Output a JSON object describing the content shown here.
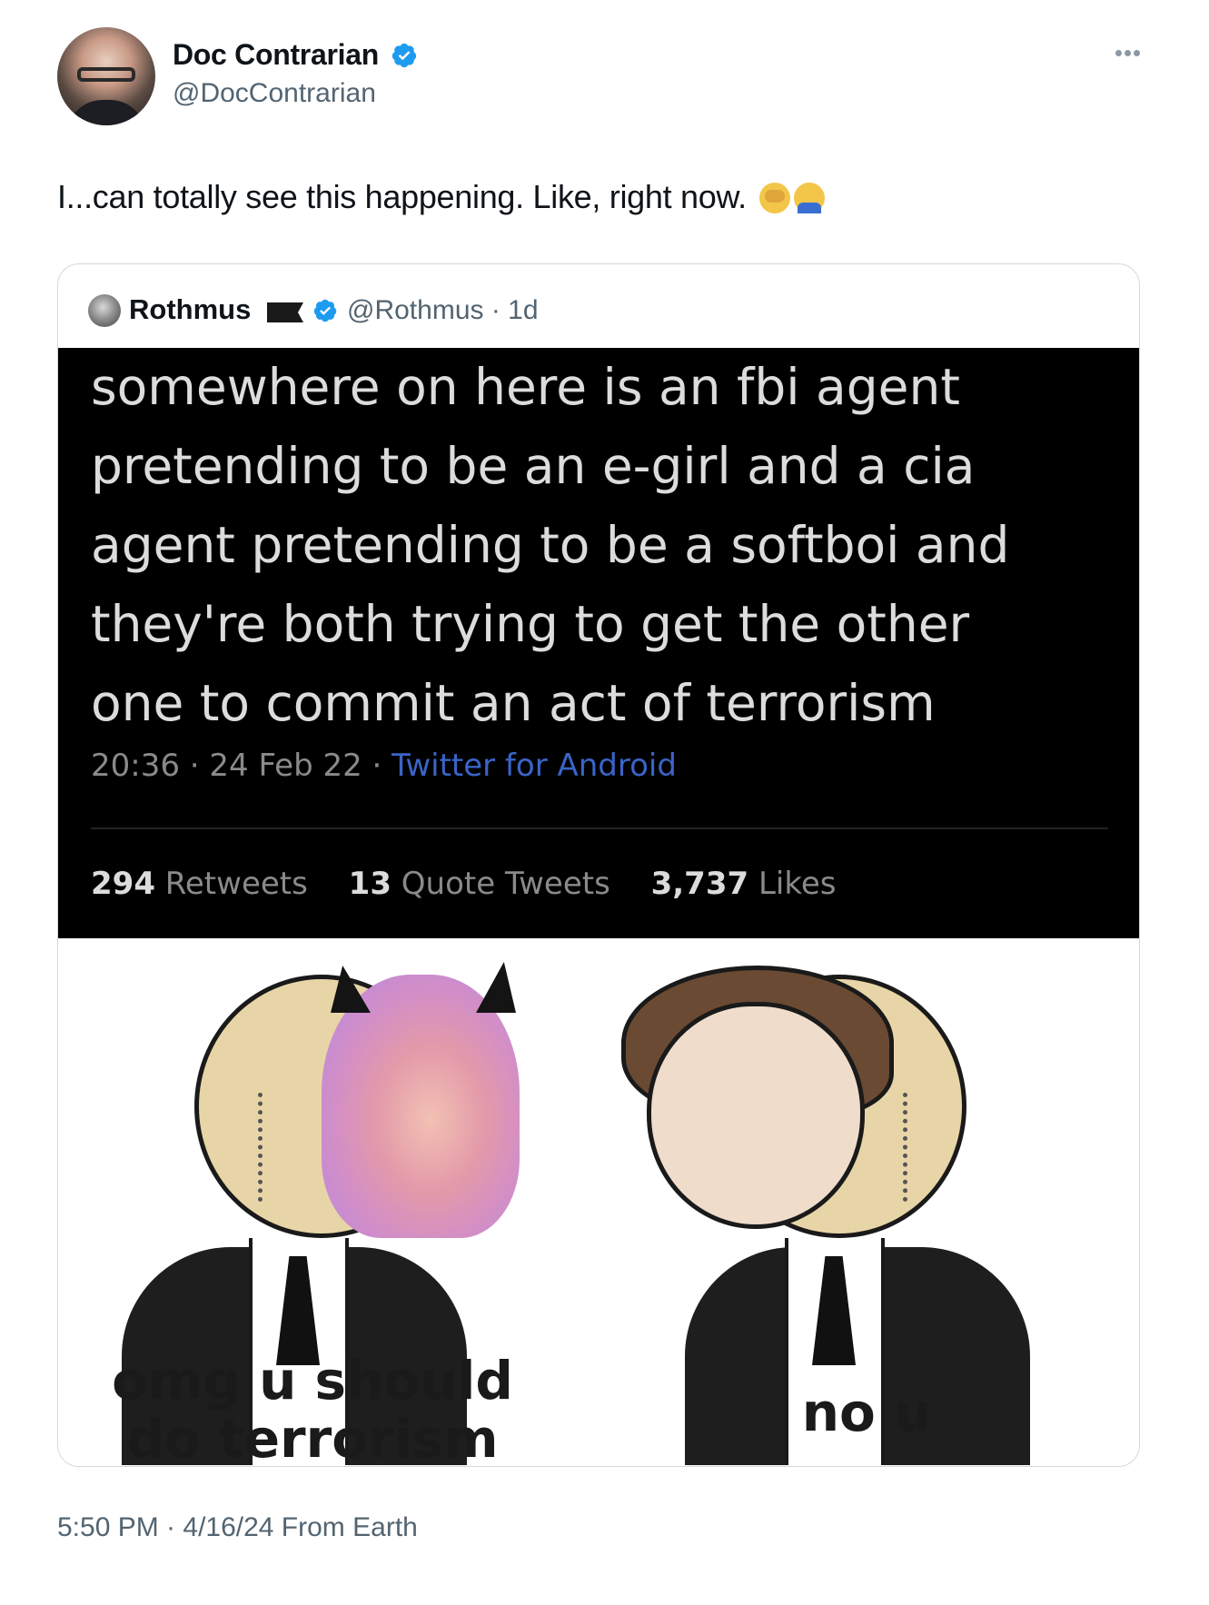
{
  "author": {
    "name": "Doc Contrarian",
    "handle": "@DocContrarian",
    "avatar_icon": "avatar-photo",
    "verified_color": "#1d9bf0"
  },
  "more_icon": "more-horizontal-icon",
  "tweet": {
    "text": "I...can totally see this happening. Like, right now.",
    "emojis": [
      "man-facepalming-emoji",
      "man-tipping-hand-emoji"
    ]
  },
  "quote": {
    "name": "Rothmus",
    "handle_time": "@Rothmus · 1d",
    "flag_icon": "black-flag-icon",
    "verified_color": "#1d9bf0"
  },
  "meme": {
    "text_lines": [
      "somewhere on here is an fbi agent",
      "pretending to be an e-girl and a cia",
      "agent pretending to be a softboi and",
      "they're both trying to get the other",
      "one to commit an act of terrorism"
    ],
    "meta_time": "20:36 · 24 Feb 22 · ",
    "meta_client": "Twitter for Android",
    "stats": {
      "retweets_count": "294",
      "retweets_label": "Retweets",
      "quotes_count": "13",
      "quotes_label": "Quote Tweets",
      "likes_count": "3,737",
      "likes_label": "Likes"
    },
    "caption_left": "omg u should do terrorism",
    "caption_right": "no u"
  },
  "timestamp": "5:50 PM · 4/16/24 From Earth"
}
